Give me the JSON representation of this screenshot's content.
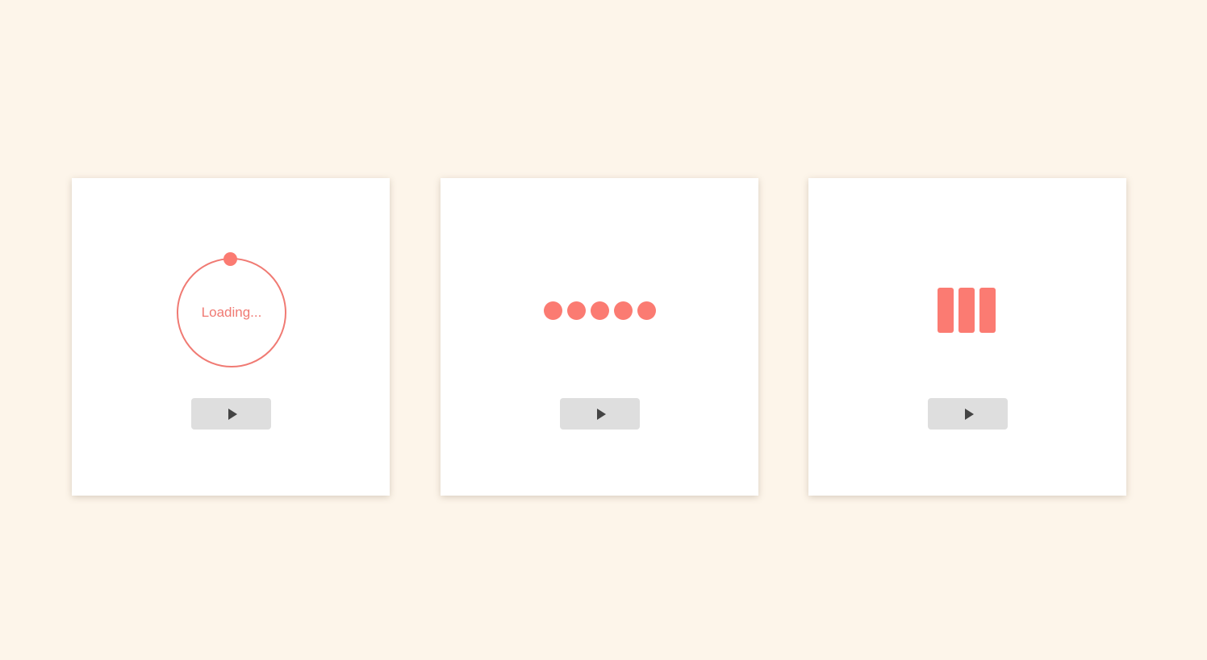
{
  "colors": {
    "background": "#fdf5ea",
    "card": "#ffffff",
    "accent": "#fb7b72",
    "button": "#dedede",
    "icon": "#444444"
  },
  "cards": [
    {
      "loader": "ring",
      "label": "Loading...",
      "button_icon": "play-icon"
    },
    {
      "loader": "dots",
      "dot_count": 5,
      "button_icon": "play-icon"
    },
    {
      "loader": "bars",
      "bar_count": 3,
      "button_icon": "play-icon"
    }
  ]
}
